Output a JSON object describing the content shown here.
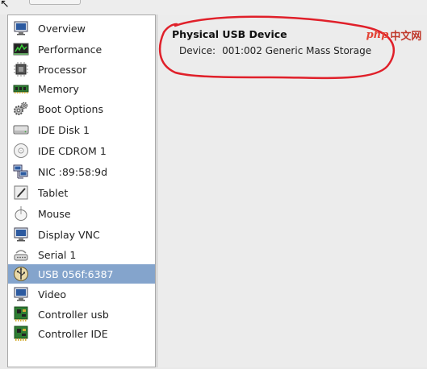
{
  "watermark": {
    "text_php": "php",
    "text_cn": "中文网"
  },
  "sidebar": {
    "items": [
      {
        "label": "Overview",
        "icon": "monitor-icon"
      },
      {
        "label": "Performance",
        "icon": "performance-chart-icon"
      },
      {
        "label": "Processor",
        "icon": "processor-chip-icon"
      },
      {
        "label": "Memory",
        "icon": "memory-module-icon"
      },
      {
        "label": "Boot Options",
        "icon": "gears-icon"
      },
      {
        "label": "IDE Disk 1",
        "icon": "hard-disk-icon"
      },
      {
        "label": "IDE CDROM 1",
        "icon": "cdrom-icon"
      },
      {
        "label": "NIC :89:58:9d",
        "icon": "network-icon"
      },
      {
        "label": "Tablet",
        "icon": "tablet-pen-icon"
      },
      {
        "label": "Mouse",
        "icon": "mouse-icon"
      },
      {
        "label": "Display VNC",
        "icon": "display-icon"
      },
      {
        "label": "Serial 1",
        "icon": "serial-port-icon"
      },
      {
        "label": "USB 056f:6387",
        "icon": "usb-icon",
        "selected": true
      },
      {
        "label": "Video",
        "icon": "video-monitor-icon"
      },
      {
        "label": "Controller usb",
        "icon": "controller-card-icon"
      },
      {
        "label": "Controller IDE",
        "icon": "controller-card-icon"
      }
    ]
  },
  "detail": {
    "title": "Physical USB Device",
    "device_label": "Device:",
    "device_value": "001:002 Generic Mass Storage"
  },
  "colors": {
    "selection": "#84a4cc",
    "annotation": "#e0202a",
    "panel_bg": "#ececec"
  }
}
